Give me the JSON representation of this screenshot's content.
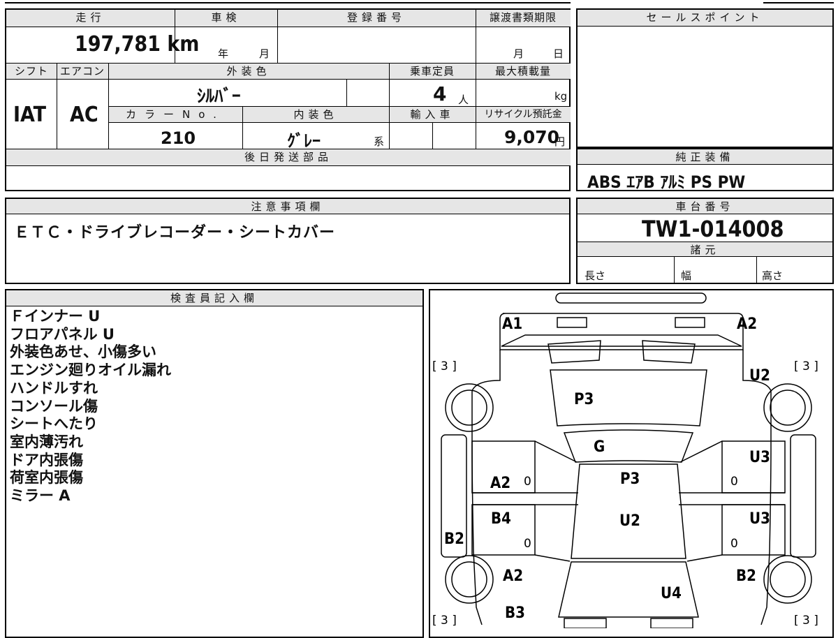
{
  "top_card": {
    "mileage": {
      "label": "走行",
      "value": "197,781 km"
    },
    "inspection": {
      "label": "車検",
      "year": "年",
      "month": "月"
    },
    "registration_number": {
      "label": "登録番号"
    },
    "transfer_docs_deadline": {
      "label": "譲渡書類期限",
      "month": "月",
      "day": "日"
    },
    "shift": {
      "label": "シフト",
      "value": "IAT"
    },
    "aircon": {
      "label": "エアコン",
      "value": "AC"
    },
    "exterior_color": {
      "label": "外装色",
      "value": "ｼﾙﾊﾞｰ"
    },
    "capacity": {
      "label": "乗車定員",
      "value": "4",
      "unit": "人"
    },
    "max_load": {
      "label": "最大積載量",
      "unit": "kg"
    },
    "color_no": {
      "label": "カラーNo.",
      "value": "210"
    },
    "interior_color": {
      "label": "内装色",
      "value": "ｸﾞﾚｰ",
      "suffix": "系"
    },
    "import": {
      "label": "輸入車"
    },
    "recycle_fee": {
      "label": "リサイクル預託金",
      "value": "9,070",
      "unit": "円"
    },
    "later_parts": {
      "label": "後日発送部品"
    }
  },
  "sales_point": {
    "label": "セールスポイント"
  },
  "standard_equipment": {
    "label": "純正装備",
    "value": "ABS ｴｱB ｱﾙﾐ PS PW"
  },
  "notice": {
    "label": "注意事項欄",
    "value": "ＥＴＣ・ドライブレコーダー・シートカバー"
  },
  "chassis": {
    "label": "車台番号",
    "value": "TW1-014008"
  },
  "specs": {
    "label": "諸元",
    "length": "長さ",
    "width": "幅",
    "height": "高さ"
  },
  "inspector": {
    "label": "検査員記入欄",
    "lines": [
      "Ｆインナー U",
      "フロアパネル U",
      "外装色あせ、小傷多い",
      "エンジン廻りオイル漏れ",
      "ハンドルすれ",
      "コンソール傷",
      "シートへたり",
      "室内薄汚れ",
      "ドア内張傷",
      "荷室内張傷",
      "ミラー A"
    ]
  },
  "diagram": {
    "tire_left_front": "[ 3 ]",
    "tire_right_front": "[ 3 ]",
    "tire_left_rear": "[ 3 ]",
    "tire_right_rear": "[ 3 ]",
    "front_left": "A1",
    "front_right": "A2",
    "hood": "P3",
    "right_front_fender": "U2",
    "windshield": "G",
    "left_front_door": "A2",
    "left_front_door_num": "0",
    "left_rear_door": "B4",
    "left_rear_door_num": "0",
    "left_side_panel": "B2",
    "roof_front": "P3",
    "roof_rear": "U2",
    "right_front_door": "U3",
    "right_front_door_num": "0",
    "right_rear_door": "U3",
    "right_rear_door_num": "0",
    "left_quarter": "A2",
    "left_rear": "B3",
    "right_quarter": "B2",
    "tailgate": "U4"
  }
}
